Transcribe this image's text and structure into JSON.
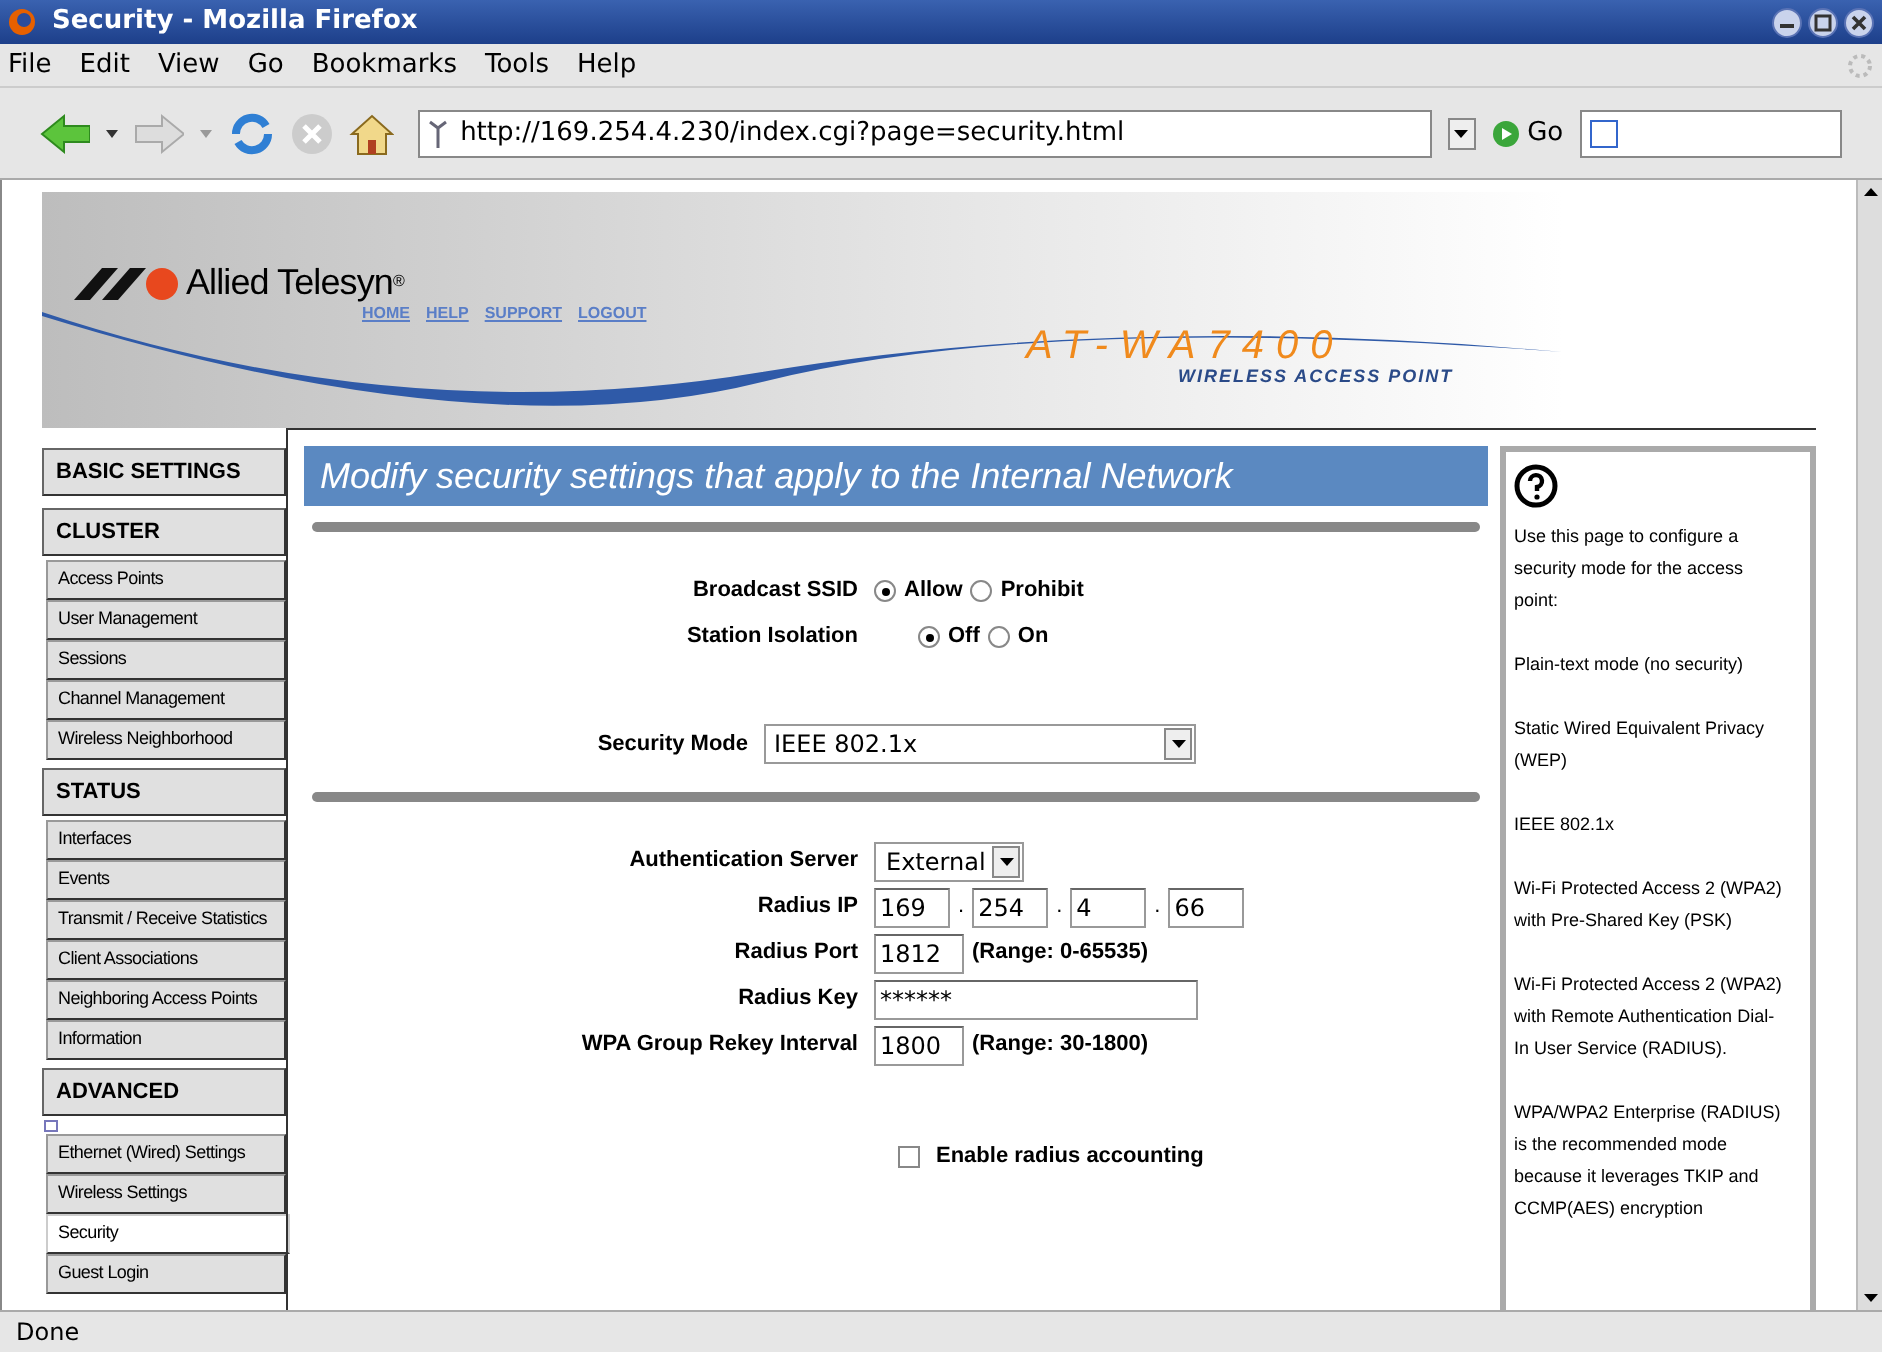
{
  "window": {
    "title": "Security - Mozilla Firefox"
  },
  "menu": [
    "File",
    "Edit",
    "View",
    "Go",
    "Bookmarks",
    "Tools",
    "Help"
  ],
  "toolbar": {
    "url": "http://169.254.4.230/index.cgi?page=security.html",
    "go": "Go"
  },
  "banner": {
    "brand": "Allied Telesyn",
    "brand_mark": "®",
    "links": [
      "HOME",
      "HELP",
      "SUPPORT",
      "LOGOUT"
    ],
    "model": "AT-WA7400",
    "subtitle": "WIRELESS ACCESS POINT"
  },
  "sidebar": [
    {
      "heading": "BASIC SETTINGS"
    },
    {
      "heading": "CLUSTER",
      "items": [
        {
          "label": "Access Points",
          "selected": false
        },
        {
          "label": "User Management",
          "selected": false
        },
        {
          "label": "Sessions",
          "selected": false
        },
        {
          "label": "Channel Management",
          "selected": false
        },
        {
          "label": "Wireless Neighborhood",
          "selected": false
        }
      ]
    },
    {
      "heading": "STATUS",
      "items": [
        {
          "label": "Interfaces",
          "selected": false
        },
        {
          "label": "Events",
          "selected": false
        },
        {
          "label": "Transmit / Receive Statistics",
          "selected": false
        },
        {
          "label": "Client Associations",
          "selected": false
        },
        {
          "label": "Neighboring Access Points",
          "selected": false
        },
        {
          "label": "Information",
          "selected": false
        }
      ]
    },
    {
      "heading": "ADVANCED",
      "collapsible": true,
      "items": [
        {
          "label": "Ethernet (Wired) Settings",
          "selected": false
        },
        {
          "label": "Wireless Settings",
          "selected": false
        },
        {
          "label": "Security",
          "selected": true
        },
        {
          "label": "Guest Login",
          "selected": false
        }
      ]
    }
  ],
  "main": {
    "title": "Modify security settings that apply to the Internal Network",
    "broadcast_ssid": {
      "label": "Broadcast SSID",
      "options": [
        {
          "label": "Allow",
          "selected": true
        },
        {
          "label": "Prohibit",
          "selected": false
        }
      ]
    },
    "station_isolation": {
      "label": "Station Isolation",
      "options": [
        {
          "label": "Off",
          "selected": true
        },
        {
          "label": "On",
          "selected": false
        }
      ]
    },
    "security_mode": {
      "label": "Security Mode",
      "value": "IEEE 802.1x"
    },
    "auth_server": {
      "label": "Authentication Server",
      "value": "External"
    },
    "radius_ip": {
      "label": "Radius IP",
      "octets": [
        "169",
        "254",
        "4",
        "66"
      ],
      "separator": "."
    },
    "radius_port": {
      "label": "Radius Port",
      "value": "1812",
      "hint": "(Range: 0-65535)"
    },
    "radius_key": {
      "label": "Radius Key",
      "value": "******"
    },
    "rekey": {
      "label": "WPA Group Rekey Interval",
      "value": "1800",
      "hint": "(Range: 30-1800)"
    },
    "accounting": {
      "label": "Enable radius accounting",
      "checked": false
    }
  },
  "help": [
    "Use this page to configure a security mode for the access point:",
    "Plain-text mode (no security)",
    "Static Wired Equivalent Privacy (WEP)",
    "IEEE 802.1x",
    "Wi-Fi Protected Access 2 (WPA2) with Pre-Shared Key (PSK)",
    "Wi-Fi Protected Access 2 (WPA2) with Remote Authentication Dial-In User Service (RADIUS).",
    "WPA/WPA2 Enterprise (RADIUS) is the recommended mode because it leverages TKIP and CCMP(AES) encryption"
  ],
  "status_bar": "Done"
}
